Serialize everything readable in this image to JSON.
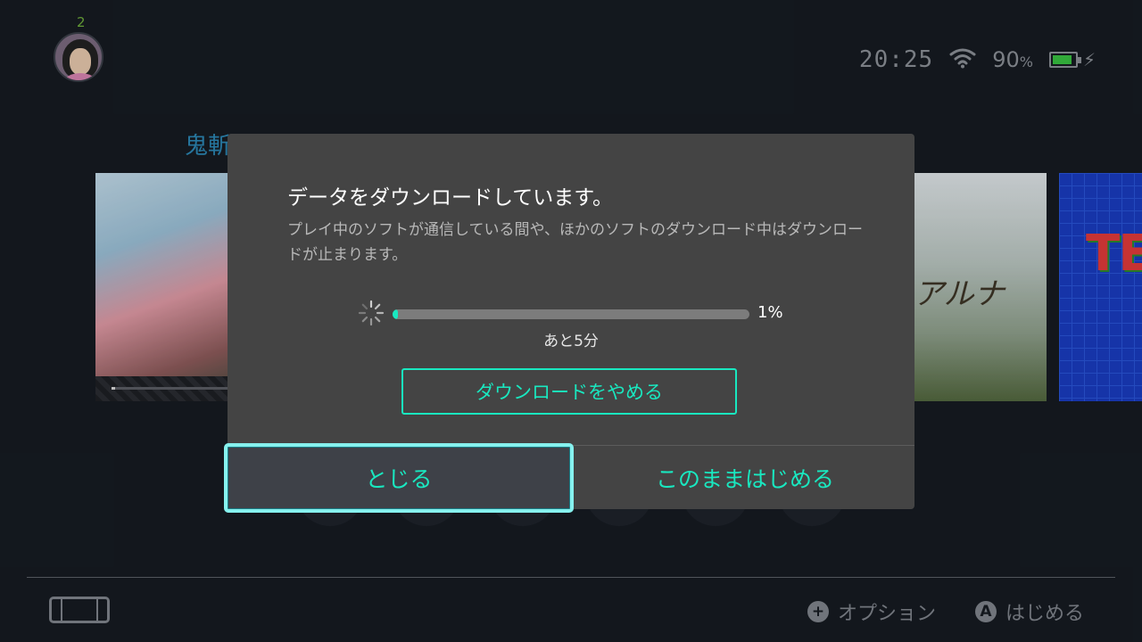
{
  "user": {
    "badge_count": "2"
  },
  "status": {
    "clock": "20:25",
    "battery_percent": "90",
    "battery_unit": "%",
    "battery_level": 0.9,
    "charging": true
  },
  "background": {
    "game_title_peek": "鬼斬",
    "tile_center_logo": "アルナ",
    "tile_right_logo": "TE",
    "tile_left_progress": 0.01
  },
  "dialog": {
    "title": "データをダウンロードしています。",
    "description": "プレイ中のソフトが通信している間や、ほかのソフトのダウンロード中はダウンロードが止まります。",
    "progress_percent_label": "1%",
    "progress_fraction": 0.01,
    "time_remaining": "あと5分",
    "cancel_download_label": "ダウンロードをやめる",
    "close_label": "とじる",
    "start_anyway_label": "このままはじめる"
  },
  "footer": {
    "options_button_glyph": "+",
    "options_label": "オプション",
    "start_button_glyph": "A",
    "start_label": "はじめる"
  },
  "colors": {
    "accent": "#19e8c0",
    "focus_ring": "#86f1ee",
    "background": "#161b22",
    "dialog": "#444444"
  }
}
